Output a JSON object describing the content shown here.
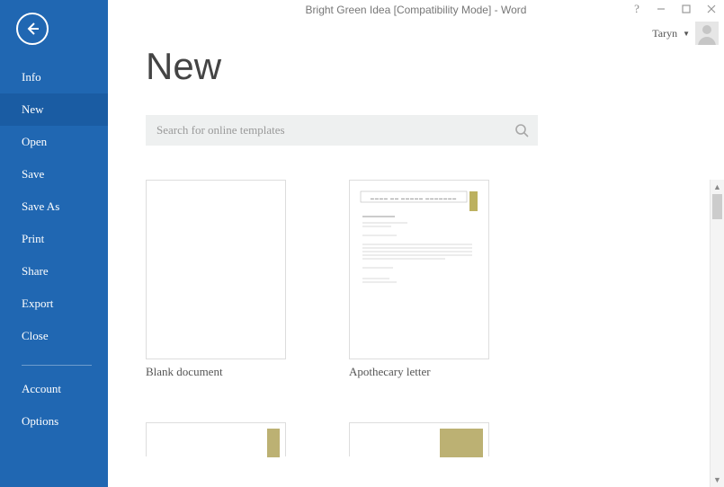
{
  "window": {
    "title": "Bright Green Idea [Compatibility Mode] - Word"
  },
  "user": {
    "name": "Taryn"
  },
  "sidebar": {
    "items": [
      {
        "label": "Info"
      },
      {
        "label": "New"
      },
      {
        "label": "Open"
      },
      {
        "label": "Save"
      },
      {
        "label": "Save As"
      },
      {
        "label": "Print"
      },
      {
        "label": "Share"
      },
      {
        "label": "Export"
      },
      {
        "label": "Close"
      }
    ],
    "footer": [
      {
        "label": "Account"
      },
      {
        "label": "Options"
      }
    ],
    "selected_index": 1
  },
  "page": {
    "title": "New",
    "search_placeholder": "Search for online templates"
  },
  "templates": [
    {
      "label": "Blank document"
    },
    {
      "label": "Apothecary letter"
    }
  ]
}
